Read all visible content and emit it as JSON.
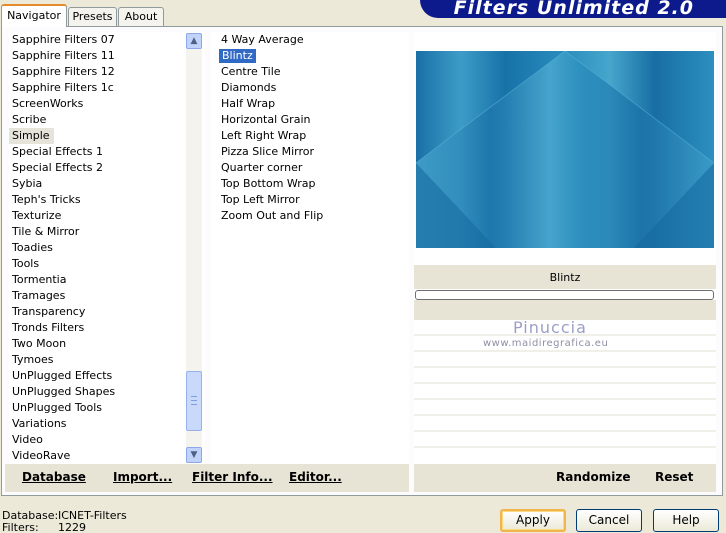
{
  "tabs": [
    {
      "label": "Navigator",
      "active": true
    },
    {
      "label": "Presets",
      "active": false
    },
    {
      "label": "About",
      "active": false
    }
  ],
  "banner_title": "Filters Unlimited 2.0",
  "categories": {
    "items": [
      "Sapphire Filters 07",
      "Sapphire Filters 11",
      "Sapphire Filters 12",
      "Sapphire Filters 1c",
      "ScreenWorks",
      "Scribe",
      "Simple",
      "Special Effects 1",
      "Special Effects 2",
      "Sybia",
      "Teph's Tricks",
      "Texturize",
      "Tile & Mirror",
      "Toadies",
      "Tools",
      "Tormentia",
      "Tramages",
      "Transparency",
      "Tronds Filters",
      "Two Moon",
      "Tymoes",
      "UnPlugged Effects",
      "UnPlugged Shapes",
      "UnPlugged Tools",
      "Variations",
      "Video",
      "VideoRave"
    ],
    "selected": "Simple",
    "scroll_up_icon": "arrow-up-icon",
    "scroll_down_icon": "arrow-down-icon"
  },
  "filters": {
    "items": [
      "4 Way Average",
      "Blintz",
      "Centre Tile",
      "Diamonds",
      "Half Wrap",
      "Horizontal Grain",
      "Left Right Wrap",
      "Pizza Slice Mirror",
      "Quarter corner",
      "Top Bottom Wrap",
      "Top Left Mirror",
      "Zoom Out and Flip"
    ],
    "selected": "Blintz",
    "selected_color": "#316ac5"
  },
  "left_bar": {
    "database": "Database",
    "import": "Import...",
    "filter_info": "Filter Info...",
    "editor": "Editor..."
  },
  "preview": {
    "filter_name": "Blintz",
    "watermark_name": "Pinuccia",
    "watermark_url": "www.maidiregrafica.eu",
    "accent": "#1e7ab0"
  },
  "right_bar": {
    "randomize": "Randomize",
    "reset": "Reset"
  },
  "status": {
    "database_label": "Database:",
    "database_value": "ICNET-Filters",
    "filters_label": "Filters:",
    "filters_value": "1229"
  },
  "dialog_buttons": {
    "apply": "Apply",
    "cancel": "Cancel",
    "help": "Help"
  }
}
